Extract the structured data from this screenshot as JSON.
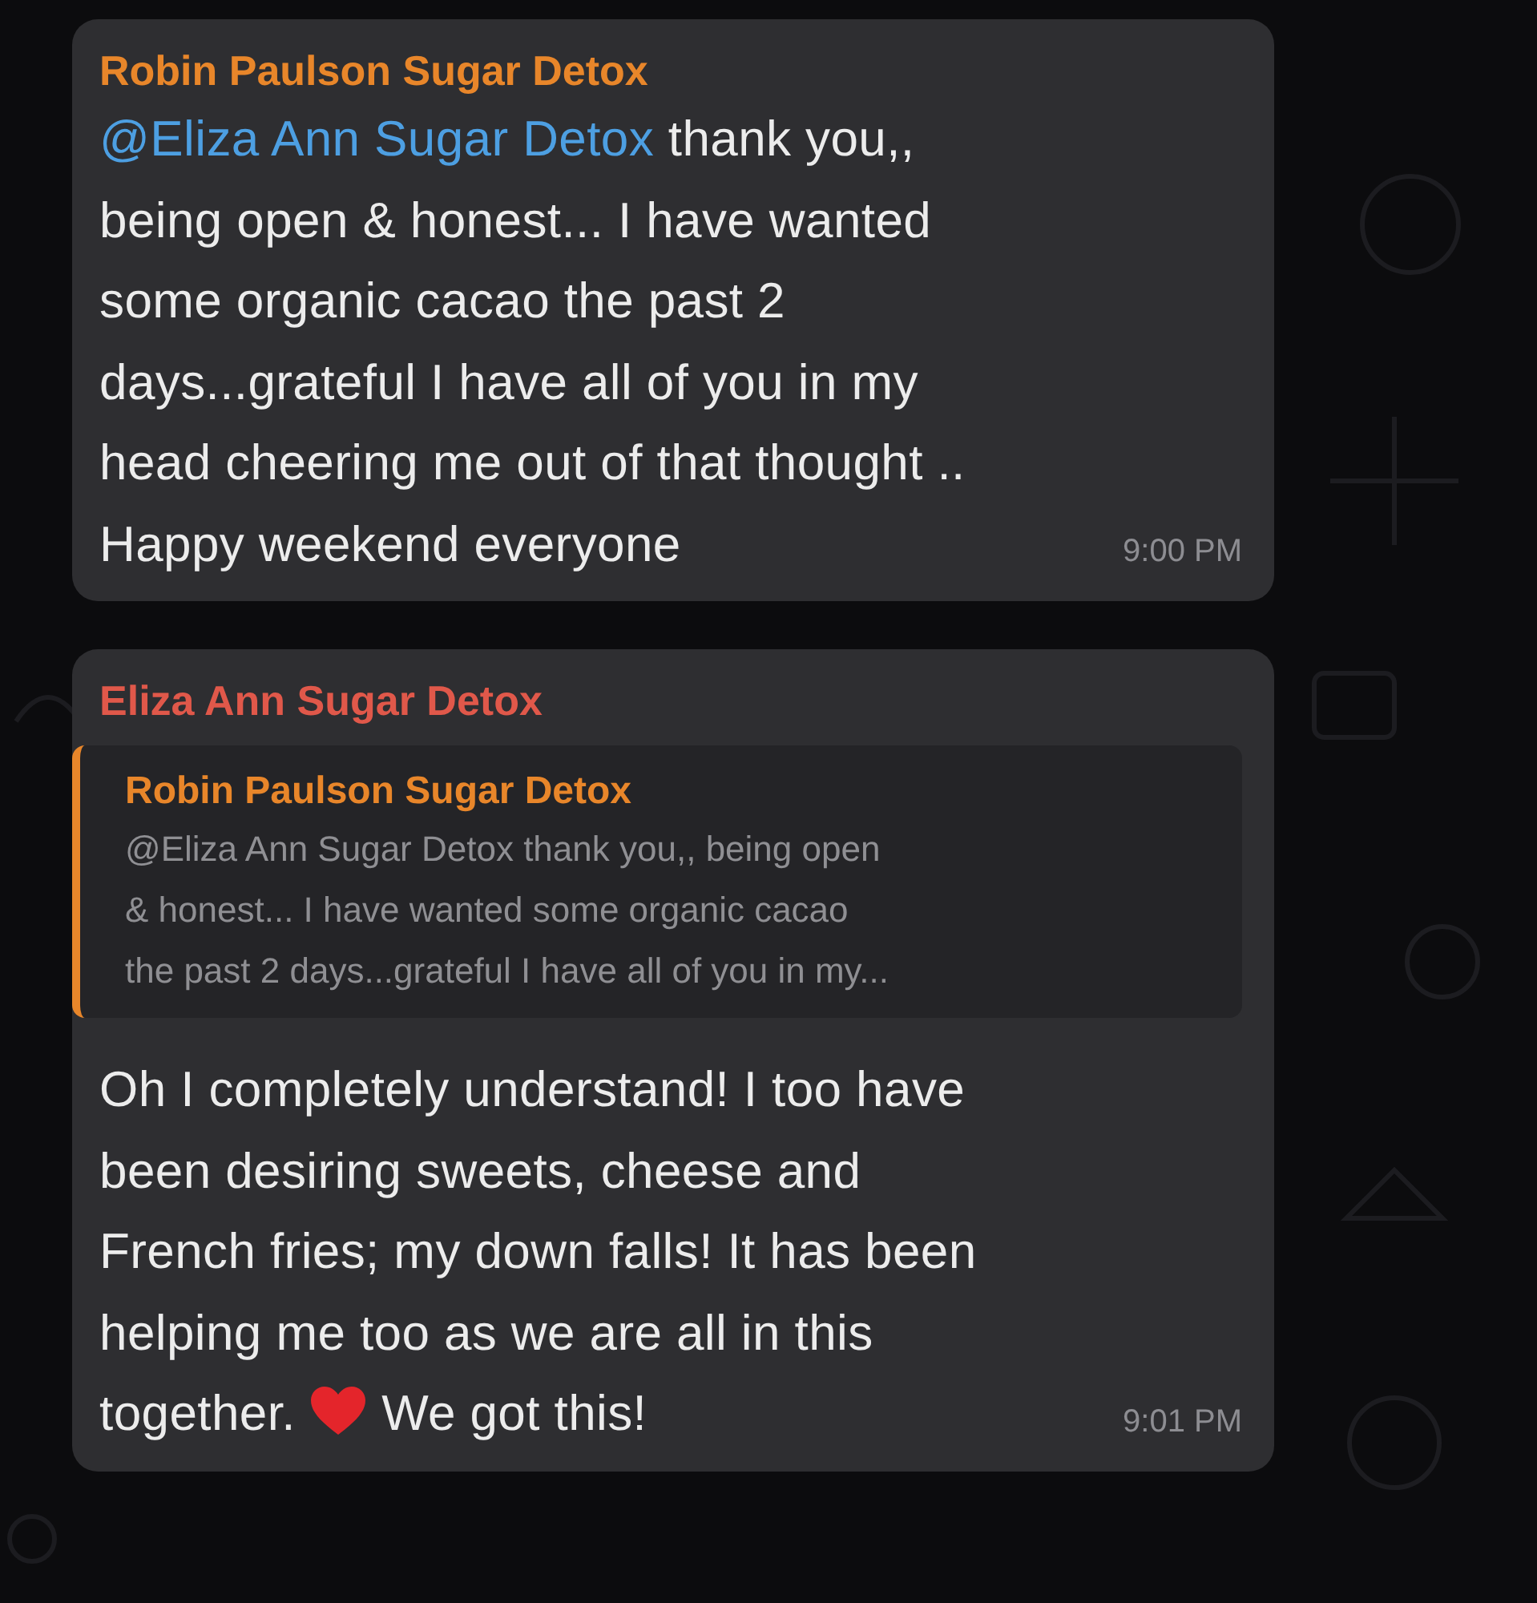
{
  "messages": [
    {
      "sender": "Robin Paulson Sugar Detox",
      "color": "#e8862a",
      "body": [
        {
          "kind": "mention",
          "text": "@Eliza Ann Sugar Detox"
        },
        {
          "kind": "text",
          "text": " thank you,,\nbeing open & honest... I have wanted\nsome organic cacao the past 2\ndays...grateful I have all of you in my\nhead cheering me out of that thought ..\nHappy weekend everyone"
        }
      ],
      "time": "9:00 PM"
    },
    {
      "sender": "Eliza Ann Sugar Detox",
      "color": "#e0584a",
      "quote": {
        "sender": "Robin Paulson Sugar Detox",
        "color": "#e8862a",
        "text": "@Eliza Ann Sugar Detox thank you,, being open\n& honest... I have wanted some organic cacao\nthe past 2 days...grateful I have all of you in my..."
      },
      "body": [
        {
          "kind": "text",
          "text": "Oh I completely understand! I too have\nbeen desiring sweets, cheese and\nFrench fries; my down falls! It has been\nhelping me too as we are all in this\ntogether. "
        },
        {
          "kind": "heart"
        },
        {
          "kind": "text",
          "text": " We got this!"
        }
      ],
      "time": "9:01 PM"
    }
  ]
}
